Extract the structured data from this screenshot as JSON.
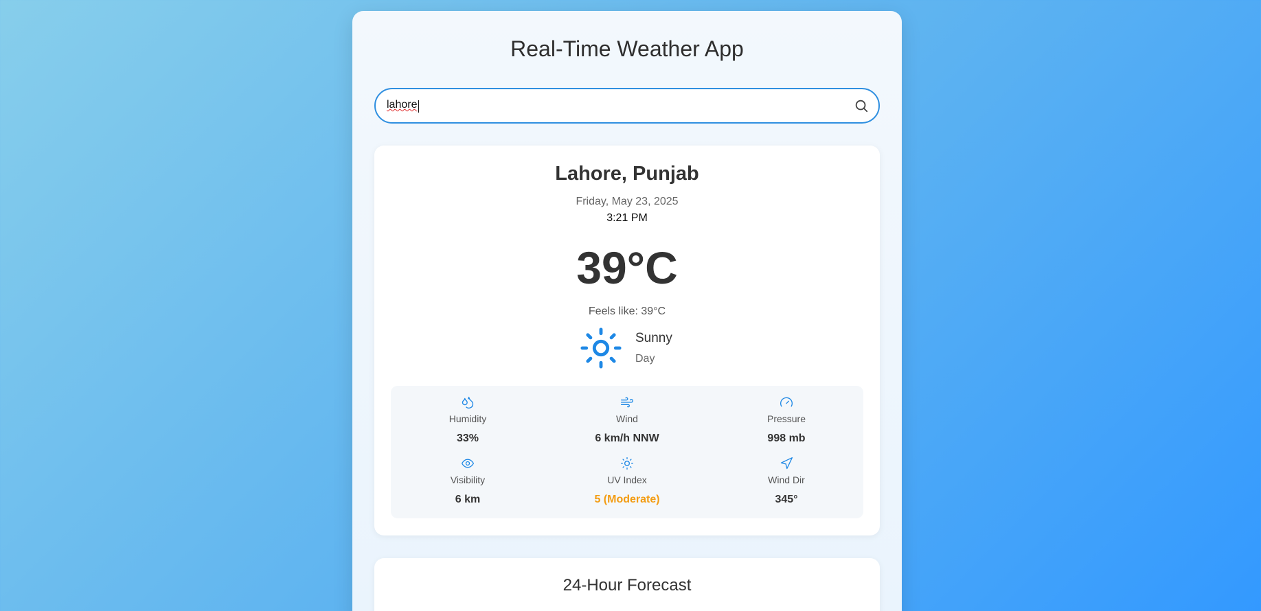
{
  "app": {
    "title": "Real-Time Weather App"
  },
  "search": {
    "value": "lahore",
    "placeholder": ""
  },
  "current": {
    "location": "Lahore, Punjab",
    "date": "Friday, May 23, 2025",
    "time": "3:21 PM",
    "temperature": "39°C",
    "feels_like": "Feels like: 39°C",
    "condition": "Sunny",
    "period": "Day",
    "condition_icon": "sun-icon"
  },
  "details": {
    "humidity": {
      "label": "Humidity",
      "value": "33%",
      "icon": "humidity-icon"
    },
    "wind": {
      "label": "Wind",
      "value": "6 km/h NNW",
      "icon": "wind-icon"
    },
    "pressure": {
      "label": "Pressure",
      "value": "998 mb",
      "icon": "gauge-icon"
    },
    "visibility": {
      "label": "Visibility",
      "value": "6 km",
      "icon": "eye-icon"
    },
    "uv": {
      "label": "UV Index",
      "value": "5 (Moderate)",
      "icon": "sun-small-icon"
    },
    "wind_dir": {
      "label": "Wind Dir",
      "value": "345°",
      "icon": "navigation-icon"
    }
  },
  "forecast": {
    "title": "24-Hour Forecast"
  },
  "colors": {
    "accent": "#2f8fe0",
    "icon": "#1e88e5",
    "uv_moderate": "#f39c12"
  }
}
